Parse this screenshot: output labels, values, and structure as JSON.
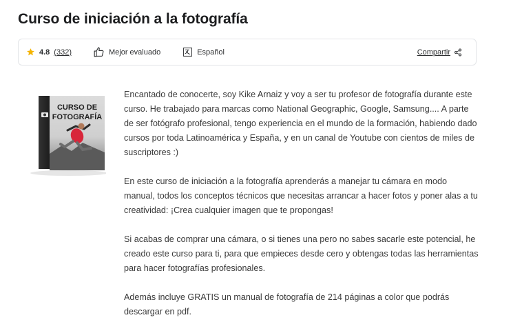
{
  "page": {
    "title": "Curso de iniciación a la fotografía"
  },
  "info_bar": {
    "rating": "4.8",
    "rating_count": "(332)",
    "badge": "Mejor evaluado",
    "language": "Español",
    "share": "Compartir"
  },
  "product_image": {
    "cover_line1": "CURSO DE",
    "cover_line2": "FOTOGRAFÍA"
  },
  "description": {
    "paragraphs": [
      "Encantado de conocerte, soy Kike Arnaiz y voy a ser tu profesor de fotografía durante este curso. He trabajado para marcas como National Geographic, Google, Samsung.... A parte de ser fotógrafo profesional, tengo experiencia en el mundo de la formación, habiendo dado cursos por toda Latinoamérica y España, y en un canal de Youtube con cientos de miles de suscriptores :)",
      "En este curso de iniciación a la fotografía aprenderás a manejar tu cámara en modo manual, todos los conceptos técnicos que necesitas arrancar a hacer fotos y poner alas a tu creatividad: ¡Crea cualquier imagen que te propongas!",
      "Si acabas de comprar una cámara, o si tienes una pero no sabes sacarle este potencial, he creado este curso para ti, para que empieces desde cero y obtengas todas las herramientas para hacer fotografías profesionales.",
      "Además incluye GRATIS un manual de fotografía de 214 páginas a color que podrás descargar en pdf."
    ]
  },
  "colors": {
    "star": "#f4b400",
    "text": "#3a3a3a",
    "title": "#1c1d1f",
    "border": "#e3e5e8"
  },
  "icons": [
    "star-icon",
    "thumbs-up-icon",
    "translate-icon",
    "share-icon",
    "camera-icon"
  ]
}
